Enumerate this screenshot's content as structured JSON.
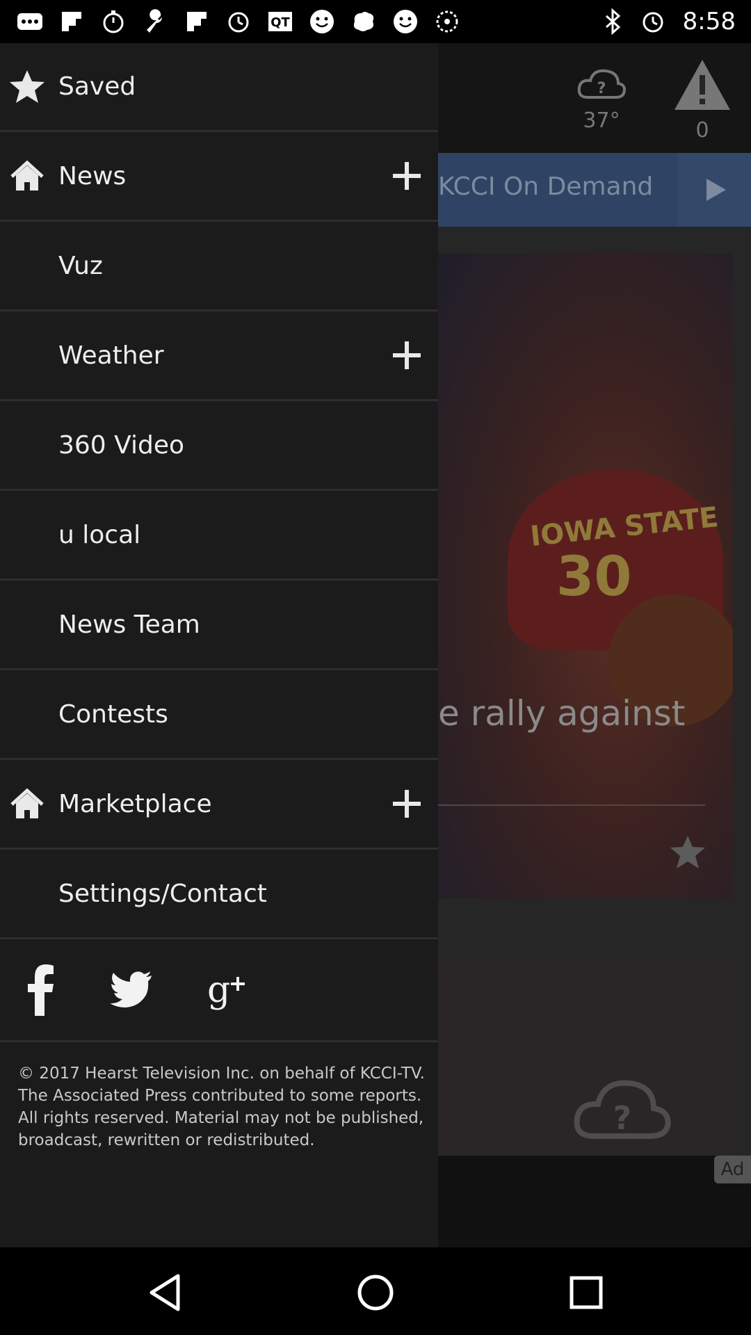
{
  "status_bar": {
    "time": "8:58",
    "left_icons": [
      "more-icon",
      "flipboard-icon",
      "stopwatch-icon",
      "wrench-icon",
      "flipboard-icon",
      "alarm-icon",
      "qt-icon",
      "smiley-icon",
      "brain-icon",
      "smiley-icon",
      "timer-icon"
    ],
    "right_icons": [
      "bluetooth-icon",
      "alarm-icon"
    ]
  },
  "background": {
    "temperature": "37°",
    "alert_count": "0",
    "on_demand_label": "KCCI On Demand",
    "headline_fragment": "e rally against",
    "jersey_text": "IOWA STATE",
    "jersey_number": "30",
    "ad_label": "Ad"
  },
  "drawer": {
    "items": [
      {
        "label": "Saved",
        "icon": "star-icon",
        "expandable": false
      },
      {
        "label": "News",
        "icon": "home-icon",
        "expandable": true
      },
      {
        "label": "Vuz",
        "icon": "",
        "expandable": false
      },
      {
        "label": "Weather",
        "icon": "",
        "expandable": true
      },
      {
        "label": "360 Video",
        "icon": "",
        "expandable": false
      },
      {
        "label": "u local",
        "icon": "",
        "expandable": false
      },
      {
        "label": "News Team",
        "icon": "",
        "expandable": false
      },
      {
        "label": "Contests",
        "icon": "",
        "expandable": false
      },
      {
        "label": "Marketplace",
        "icon": "home-icon",
        "expandable": true
      },
      {
        "label": "Settings/Contact",
        "icon": "",
        "expandable": false
      }
    ],
    "social": [
      "facebook-icon",
      "twitter-icon",
      "google-plus-icon"
    ],
    "copyright": "© 2017 Hearst Television Inc. on behalf of KCCI-TV. The Associated Press contributed to some reports. All rights reserved. Material may not be published, broadcast, rewritten or redistributed."
  },
  "nav_bar": {
    "buttons": [
      "back-icon",
      "home-icon",
      "recents-icon"
    ]
  },
  "colors": {
    "drawer_bg": "#1b1b1b",
    "on_demand_bar": "#2f4464",
    "text": "#eeeeee"
  }
}
